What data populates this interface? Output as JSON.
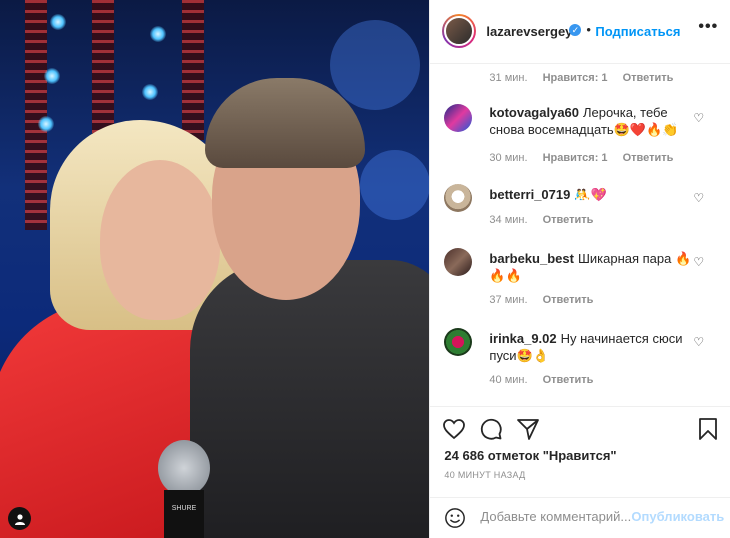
{
  "photo": {
    "mic_brand": "SHURE"
  },
  "header": {
    "username": "lazarevsergey",
    "dot": "•",
    "follow_label": "Подписаться",
    "more_icon": "more-horizontal-icon"
  },
  "top_meta": {
    "time": "31 мин.",
    "likes": "Нравится: 1",
    "reply": "Ответить"
  },
  "comments": [
    {
      "username": "kotovagalya60",
      "text": "Лерочка, тебе снова восемнадцать🤩❤️🔥👏",
      "time": "30 мин.",
      "likes": "Нравится: 1",
      "reply": "Ответить"
    },
    {
      "username": "betterri_0719",
      "text": "🤼💖",
      "time": "34 мин.",
      "reply": "Ответить"
    },
    {
      "username": "barbeku_best",
      "text": "Шикарная пара 🔥🔥🔥",
      "time": "37 мин.",
      "reply": "Ответить"
    },
    {
      "username": "irinka_9.02",
      "text": "Ну начинается сюси пуси🤩👌",
      "time": "40 мин.",
      "reply": "Ответить"
    }
  ],
  "actions": {
    "likes_count": "24 686 отметок \"Нравится\"",
    "time_ago": "40 МИНУТ НАЗАД"
  },
  "add_comment": {
    "placeholder": "Добавьте комментарий...",
    "publish": "Опубликовать"
  },
  "colors": {
    "link": "#0095f6",
    "publish_disabled": "#b3dbff",
    "muted": "#8e8e8e",
    "text": "#262626"
  }
}
